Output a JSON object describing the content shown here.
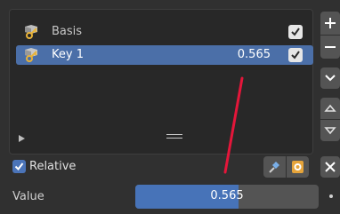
{
  "shape_keys": [
    {
      "name": "Basis",
      "value": "",
      "enabled": true,
      "selected": false
    },
    {
      "name": "Key 1",
      "value": "0.565",
      "enabled": true,
      "selected": true
    }
  ],
  "relative": {
    "label": "Relative",
    "checked": true
  },
  "value_row": {
    "label": "Value",
    "value": "0.565",
    "fraction": 0.565
  },
  "icons": {
    "add": "plus-icon",
    "remove": "minus-icon",
    "menu": "chevron-down-icon",
    "move_up": "triangle-up-icon",
    "move_down": "triangle-down-icon",
    "pin": "pin-icon",
    "edit_mode": "edit-mode-icon",
    "clear": "close-icon",
    "key": "shape-key-icon"
  },
  "colors": {
    "selection": "#4b6fa8",
    "slider_fill": "#4773b8",
    "annotation": "#e4163a"
  }
}
